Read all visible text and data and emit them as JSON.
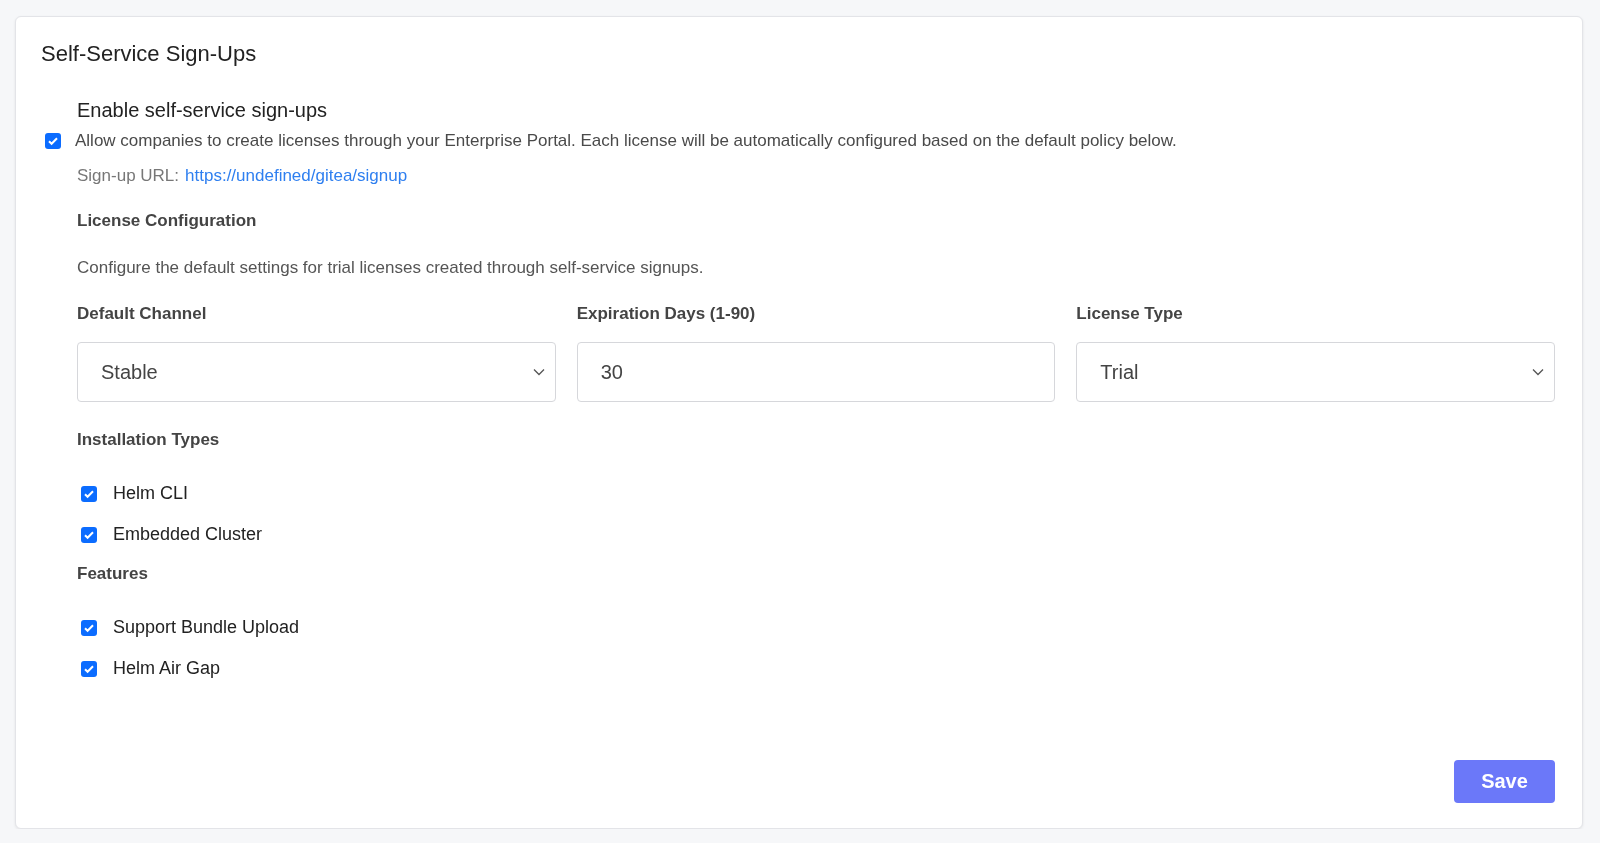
{
  "card": {
    "title": "Self-Service Sign-Ups"
  },
  "enable": {
    "heading": "Enable self-service sign-ups",
    "checked": true,
    "description": "Allow companies to create licenses through your Enterprise Portal. Each license will be automatically configured based on the default policy below."
  },
  "signup_url": {
    "label": "Sign-up URL:",
    "link": "https://undefined/gitea/signup"
  },
  "license_configuration": {
    "heading": "License Configuration",
    "description": "Configure the default settings for trial licenses created through self-service signups.",
    "fields": [
      {
        "label": "Default Channel",
        "kind": "select",
        "value": "Stable"
      },
      {
        "label": "Expiration Days (1-90)",
        "kind": "input",
        "value": "30"
      },
      {
        "label": "License Type",
        "kind": "select",
        "value": "Trial"
      }
    ]
  },
  "installation_types": {
    "heading": "Installation Types",
    "options": [
      {
        "label": "Helm CLI",
        "checked": true
      },
      {
        "label": "Embedded Cluster",
        "checked": true
      }
    ]
  },
  "features": {
    "heading": "Features",
    "options": [
      {
        "label": "Support Bundle Upload",
        "checked": true
      },
      {
        "label": "Helm Air Gap",
        "checked": true
      }
    ]
  },
  "buttons": {
    "save": "Save"
  }
}
